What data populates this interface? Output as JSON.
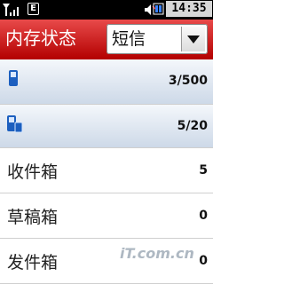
{
  "status_bar": {
    "network_badge": "E",
    "time": "14:35"
  },
  "header": {
    "title": "内存状态",
    "dropdown_value": "短信"
  },
  "rows": [
    {
      "count": "3/500",
      "icon": "phone-memory-icon"
    },
    {
      "count": "5/20",
      "icon": "sim-card-icon"
    },
    {
      "label": "收件箱",
      "count": "5"
    },
    {
      "label": "草稿箱",
      "count": "0"
    },
    {
      "label": "发件箱",
      "count": "0"
    }
  ],
  "watermark": "iT.com.cn",
  "colors": {
    "header_red": "#d01818",
    "memory_row_blue": "#cdd9e8"
  }
}
